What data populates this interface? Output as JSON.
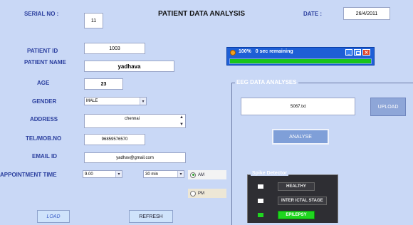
{
  "header": {
    "serial_label": "SERIAL NO :",
    "serial_value": "11",
    "title": "PATIENT DATA ANALYSIS",
    "date_label": "DATE :",
    "date_value": "26/4/2011"
  },
  "form": {
    "patient_id_label": "PATIENT ID",
    "patient_id_value": "1003",
    "patient_name_label": "PATIENT NAME",
    "patient_name_value": "yadhava",
    "age_label": "AGE",
    "age_value": "23",
    "gender_label": "GENDER",
    "gender_value": "MALE",
    "address_label": "ADDRESS",
    "address_value": "chennai",
    "tel_label": "TEL/MOB.NO",
    "tel_value": "96859576570",
    "email_label": "EMAIL ID",
    "email_value": "yadhav@gmail.com",
    "appointment_label": "APPOINTMENT TIME",
    "time_hour": "9.00",
    "time_minutes": "30 min",
    "am_label": "AM",
    "pm_label": "PM",
    "ampm_selected": "AM"
  },
  "progress": {
    "text": "100%   0 sec remaining",
    "percent": 100,
    "bar_color": "#19c419"
  },
  "eeg": {
    "group_title": "EEG DATA ANALYSES",
    "file_value": "S067.txt",
    "upload_label": "UPLOAD",
    "analyse_label": "ANALYSE"
  },
  "spike": {
    "title": "Spike Detector",
    "items": [
      {
        "label": "HEALTHY",
        "active": false
      },
      {
        "label": "INTER ICTAL STAGE",
        "active": false
      },
      {
        "label": "EPILEPSY",
        "active": true
      }
    ],
    "active_color": "#1fd61f"
  },
  "buttons": {
    "load_label": "LOAD",
    "refresh_label": "REFRESH"
  },
  "icons": {
    "progress_window_icon": "globe-icon",
    "minimize": "minimize-icon",
    "maximize": "maximize-icon",
    "close": "close-icon"
  }
}
